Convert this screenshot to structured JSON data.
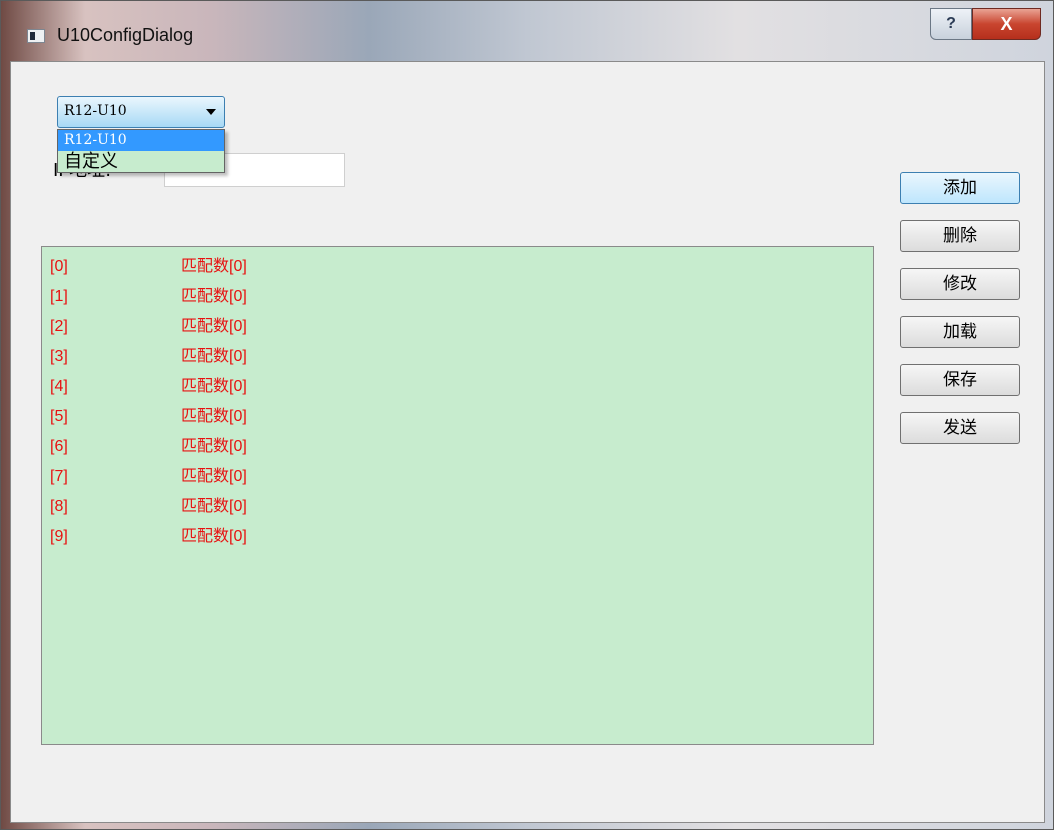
{
  "window": {
    "title": "U10ConfigDialog",
    "help_glyph": "?",
    "close_glyph": "X"
  },
  "combo": {
    "selected": "R12-U10",
    "options": [
      "R12-U10",
      "自定义"
    ]
  },
  "field": {
    "label": "IP地址:",
    "value": ""
  },
  "list": {
    "rows": [
      {
        "index": "[0]",
        "count": "匹配数[0]"
      },
      {
        "index": "[1]",
        "count": "匹配数[0]"
      },
      {
        "index": "[2]",
        "count": "匹配数[0]"
      },
      {
        "index": "[3]",
        "count": "匹配数[0]"
      },
      {
        "index": "[4]",
        "count": "匹配数[0]"
      },
      {
        "index": "[5]",
        "count": "匹配数[0]"
      },
      {
        "index": "[6]",
        "count": "匹配数[0]"
      },
      {
        "index": "[7]",
        "count": "匹配数[0]"
      },
      {
        "index": "[8]",
        "count": "匹配数[0]"
      },
      {
        "index": "[9]",
        "count": "匹配数[0]"
      }
    ],
    "text_color": "#e81111",
    "background": "#c7ecce"
  },
  "buttons": {
    "add": "添加",
    "delete": "删除",
    "modify": "修改",
    "load": "加载",
    "save": "保存",
    "send": "发送"
  }
}
